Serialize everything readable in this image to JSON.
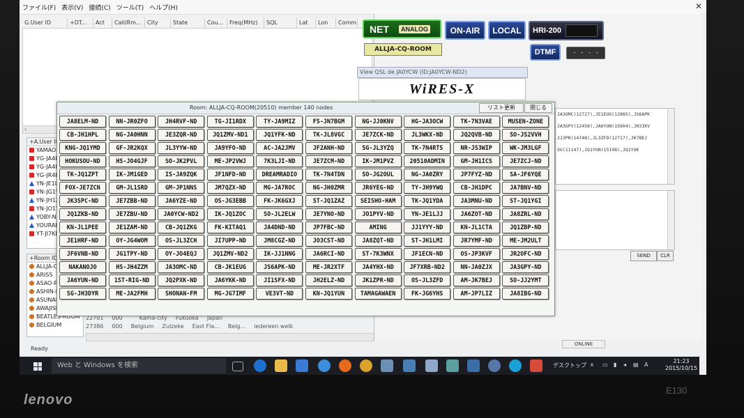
{
  "menu": [
    "ファイル(F)",
    "表示(V)",
    "接続(C)",
    "ツール(T)",
    "ヘルプ(H)"
  ],
  "window_close": "✕",
  "user_columns": [
    "G.User ID",
    "+DT...",
    "Act",
    "Call/Rm...",
    "City",
    "State",
    "Cou...",
    "Freq(MHz)",
    "SQL",
    "Lat",
    "Lon",
    "Comm"
  ],
  "user_list": {
    "header": "+A.User ID",
    "items": [
      {
        "label": "YAMAOKU",
        "icon": "d"
      },
      {
        "label": "YG-JA4FHV",
        "icon": "d"
      },
      {
        "label": "YG-JA4ICB",
        "icon": "d"
      },
      {
        "label": "YG-JR4HJP",
        "icon": "d"
      },
      {
        "label": "YN-JE1LJJ",
        "icon": "a"
      },
      {
        "label": "YN-JG1WJG",
        "icon": "d"
      },
      {
        "label": "YN-JH1ZBV",
        "icon": "a"
      },
      {
        "label": "YN-JO1YDG",
        "icon": "d"
      },
      {
        "label": "YOBY-ND",
        "icon": "a"
      },
      {
        "label": "YOURAKUC...",
        "icon": "a"
      },
      {
        "label": "YT-JI7KRA",
        "icon": "d"
      }
    ]
  },
  "room_list": {
    "header": "+Room ID",
    "items": [
      "ALLJA-CQ-ROOM",
      "ARISS",
      "ASAO-ROOM",
      "ASHIN-ROOM",
      "ASUNARO-ROOM",
      "AWAJISHIMA-...",
      "BEATLES-ROOM",
      "BELGIUM"
    ]
  },
  "bg_rows": [
    [
      "22701",
      "000",
      "",
      "Kama-city",
      "Fukuoka",
      "Japan",
      ""
    ],
    [
      "27386",
      "000",
      "Belgium",
      "Zulzeke",
      "East Fla...",
      "Belg...",
      "iedereen welk"
    ]
  ],
  "status": "Ready",
  "controls": {
    "net_label": "NET",
    "analog_label": "ANALOG",
    "on_air_label": "ON-AIR",
    "local_label": "LOCAL",
    "hri_label": "HRI-200",
    "room_label": "ALLJA-CQ-ROOM",
    "dtmf_label": "DTMF",
    "dtmf_value": "- - - -"
  },
  "qsl_title": "View QSL de JA0YCW (ID:JA0YCW-ND2)",
  "wiresx_logo": "WiRES-X",
  "log_lines": [
    "JA3OMC(12727),JE1EUG(12885),JS6APK",
    "JA3GPY(12458),JA6YUN(15604),JH3IKV",
    "JJ2PR(14748),JL3ZFD(12717),JK7BEJ",
    "SU(11147),JQ1YUN(15198),JQ1YUK"
  ],
  "send_label": "SEND",
  "clr_label": "CLR",
  "online_label": "ONLINE",
  "dialog": {
    "title": "Room: ALLJA-CQ-ROOM(20510) member 140 nodes",
    "refresh_label": "リスト更新",
    "close_label": "閉じる",
    "nodes": [
      "JA8ELM-ND",
      "NN-JR0ZFO",
      "JH4RVF-ND",
      "TG-JI1RDX",
      "TY-JA9MIZ",
      "FS-JN7BGM",
      "NG-JJ0KNV",
      "HG-JA3OCW",
      "TK-7N3VAE",
      "MUSEN-ZONE",
      "CB-JH1HPL",
      "NG-JA0HNN",
      "JE3ZQR-ND",
      "JQ1ZMV-ND1",
      "JQ1YFK-ND",
      "TK-JL8VGC",
      "JE7ZCK-ND",
      "JL3WKX-ND",
      "JQ2QVB-ND",
      "SO-JS2VVH",
      "KNG-JQ1YMD",
      "GF-JR2KQX",
      "JL3YYW-ND",
      "JA9YFO-ND",
      "AC-JA2JMV",
      "JF2ANH-ND",
      "SG-JL3YZQ",
      "TK-7N4RTS",
      "NR-JS3WIP",
      "WK-JM3LGF",
      "HOKUSOU-ND",
      "HS-JO4GJF",
      "SO-JK2PVL",
      "ME-JP2VWJ",
      "7K3LJI-ND",
      "JE7ZCM-ND",
      "IK-JM1PVZ",
      "20510ADMIN",
      "GM-JH1ICS",
      "JE7ZCJ-ND",
      "TK-JQ1ZPT",
      "IK-JM1GED",
      "IS-JA9ZQK",
      "JF1NFD-ND",
      "DREAMRADIO",
      "TK-7N4TDN",
      "SO-JG2OUL",
      "NG-JA0ZRY",
      "JP7FYZ-ND",
      "SA-JF6YQE",
      "FOX-JE7ZCN",
      "GM-JL1SRD",
      "GM-JP1NNS",
      "JM7QZX-ND",
      "MG-JA7ROC",
      "NG-JH0ZMR",
      "JR6YEG-ND",
      "TY-JH9YWQ",
      "CB-JH1DPC",
      "JA7BNV-ND",
      "JK3SPC-ND",
      "JE7ZBB-ND",
      "JA6YZE-ND",
      "OS-JG3EBB",
      "FK-JK6GXJ",
      "ST-JQ1ZAZ",
      "SEISHO-HAM",
      "TK-JQ1YDA",
      "JA3MNU-ND",
      "ST-JQ1YGI",
      "JQ1ZKB-ND",
      "JE7ZBU-ND",
      "JA0YCW-ND2",
      "IK-JQ1ZOC",
      "SO-JL2ELW",
      "JE7YNO-ND",
      "JO1PYV-ND",
      "YN-JE1LJJ",
      "JA6ZOT-ND",
      "JA8ZRL-ND",
      "KN-JL1PEE",
      "JE1ZAM-ND",
      "CB-JQ1ZKG",
      "FK-KITAQ1",
      "JA4DND-ND",
      "JP7FBC-ND",
      "AMING",
      "JJ1YYY-ND",
      "KN-JL1CTA",
      "JQ1ZBP-ND",
      "JE1HRF-ND",
      "OY-JG4WOM",
      "OS-JL3ZCH",
      "JI7UPP-ND",
      "JM8CGZ-ND",
      "JO3CST-ND",
      "JA8ZQT-ND",
      "ST-JH1LMI",
      "JR7YMF-ND",
      "ME-JM2ULT",
      "JF6VNB-ND",
      "JG1TPY-ND",
      "OY-JO4EQJ",
      "JQ1ZMV-ND2",
      "IK-JJ1NNG",
      "JA6RCI-ND",
      "ST-7K3WNX",
      "JF1ECN-ND",
      "OS-JP3KVF",
      "JR2OFC-ND",
      "NAKANOJO",
      "HS-JH4ZZM",
      "JA3OMC-ND",
      "CB-JK1EUG",
      "JS6APK-ND",
      "ME-JR2XTF",
      "JA4YHX-ND",
      "JF7XRB-ND2",
      "NN-JA0ZJX",
      "JA3GPY-ND",
      "JA6YUN-ND",
      "1ST-RIG-ND",
      "JQ2PXK-ND",
      "JA6YKK-ND",
      "JI1SFX-ND",
      "JH2ELZ-ND",
      "JK1ZPR-ND",
      "OS-JL3ZFD",
      "AM-JK7BEJ",
      "SO-JJ2YMT",
      "SG-JH3DYR",
      "ME-JA2FMH",
      "SHONAN-FM",
      "MG-JG7IMF",
      "VE3VT-ND",
      "KN-JQ1YUN",
      "TAMAGAWAEN",
      "FK-JG6YHS",
      "AM-JP7LIZ",
      "JA8IBG-ND"
    ]
  },
  "taskbar": {
    "search_text": "Web と Windows を検索",
    "desktop_label": "デスクトップ",
    "time": "21:23",
    "date": "2015/10/15"
  },
  "bezel": {
    "brand": "lenovo",
    "model": "E130"
  }
}
